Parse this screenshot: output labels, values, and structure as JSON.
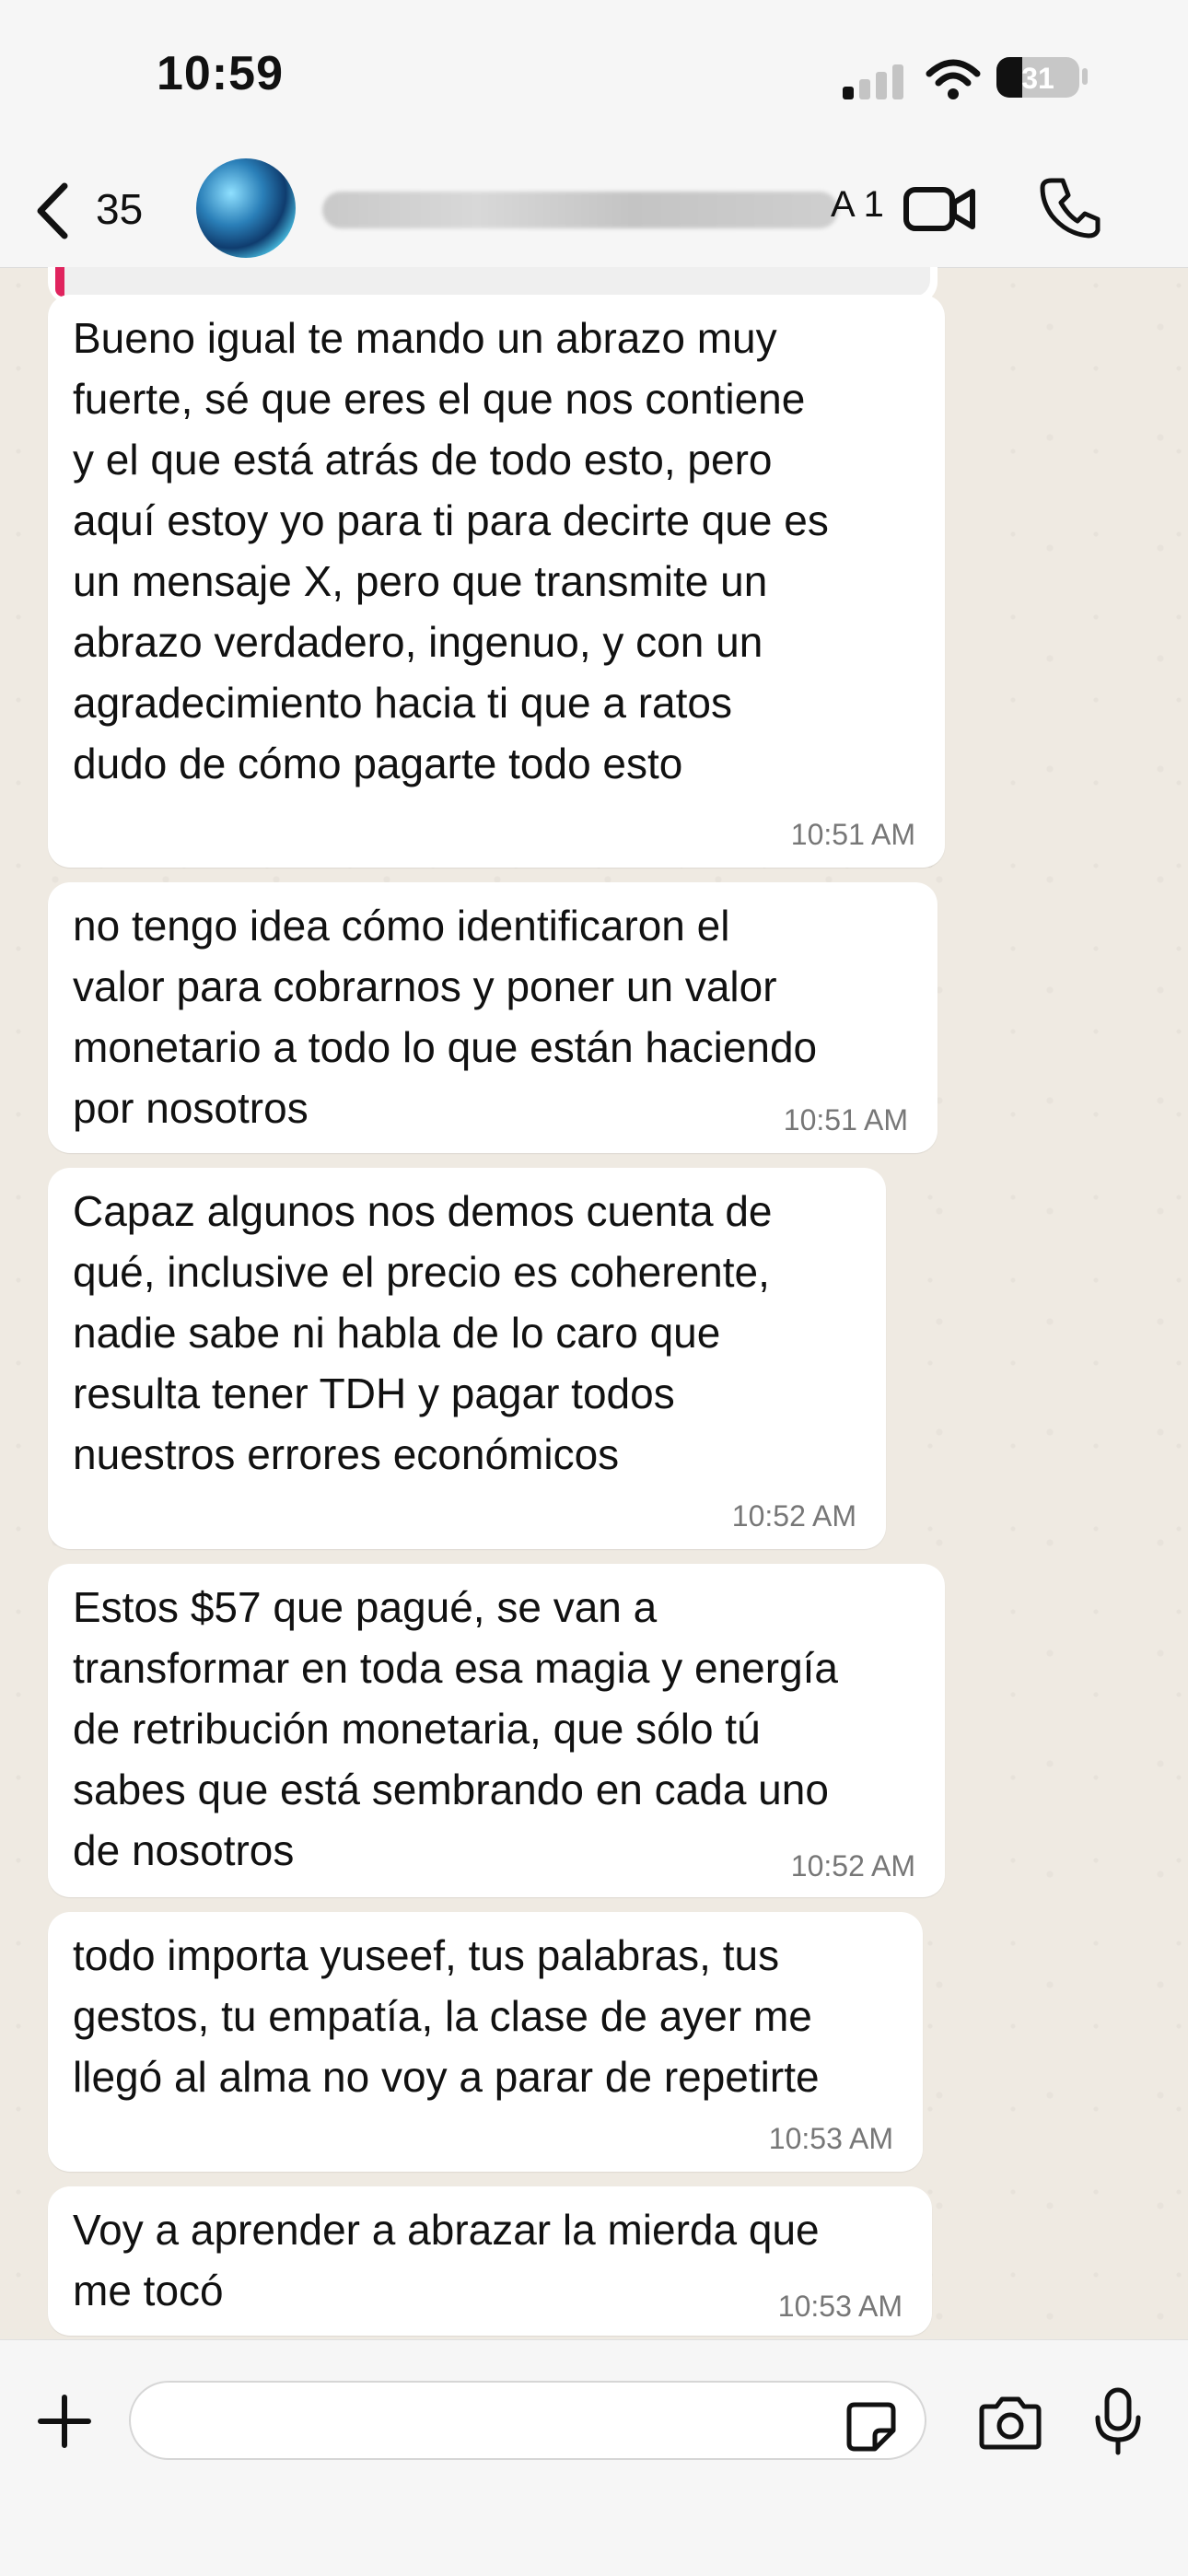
{
  "status_bar": {
    "time": "10:59",
    "battery": "31"
  },
  "header": {
    "back_count": "35",
    "contact_suffix": "A 1"
  },
  "messages": [
    {
      "text": "Bueno igual te mando un abrazo muy\nfuerte, sé que eres el que nos contiene\ny el que está atrás de todo esto, pero\naquí estoy yo para ti para decirte que es\nun mensaje X, pero que transmite un\nabrazo verdadero, ingenuo, y con un\nagradecimiento hacia ti que a ratos\ndudo de cómo pagarte todo esto",
      "time": "10:51 AM"
    },
    {
      "text": "no tengo idea cómo identificaron el\nvalor para cobrarnos y poner un valor\nmonetario a todo lo que están haciendo\npor nosotros",
      "time": "10:51 AM"
    },
    {
      "text": "Capaz algunos nos demos cuenta de\nqué, inclusive el precio es coherente,\nnadie sabe ni habla de lo caro que\nresulta tener TDH y pagar todos\nnuestros errores económicos",
      "time": "10:52 AM"
    },
    {
      "text": "Estos $57 que pagué, se van a\ntransformar en toda esa magia y energía\nde retribución monetaria, que sólo tú\nsabes que está sembrando en cada uno\nde nosotros",
      "time": "10:52 AM"
    },
    {
      "text": "todo importa yuseef, tus palabras, tus\ngestos, tu empatía, la clase de ayer me\nllegó al alma no voy a parar de repetirte",
      "time": "10:53 AM"
    },
    {
      "text": "Voy a aprender a abrazar la mierda que\nme tocó",
      "time": "10:53 AM"
    }
  ],
  "composer": {
    "placeholder": ""
  },
  "icons": {
    "back": "chevron-left-icon",
    "video": "video-camera-icon",
    "call": "phone-icon",
    "attach": "plus-icon",
    "sticker": "sticker-icon",
    "camera": "camera-icon",
    "mic": "microphone-icon"
  },
  "colors": {
    "chat_bg": "#efeae2",
    "bubble": "#ffffff",
    "reply_accent": "#e0245e"
  }
}
